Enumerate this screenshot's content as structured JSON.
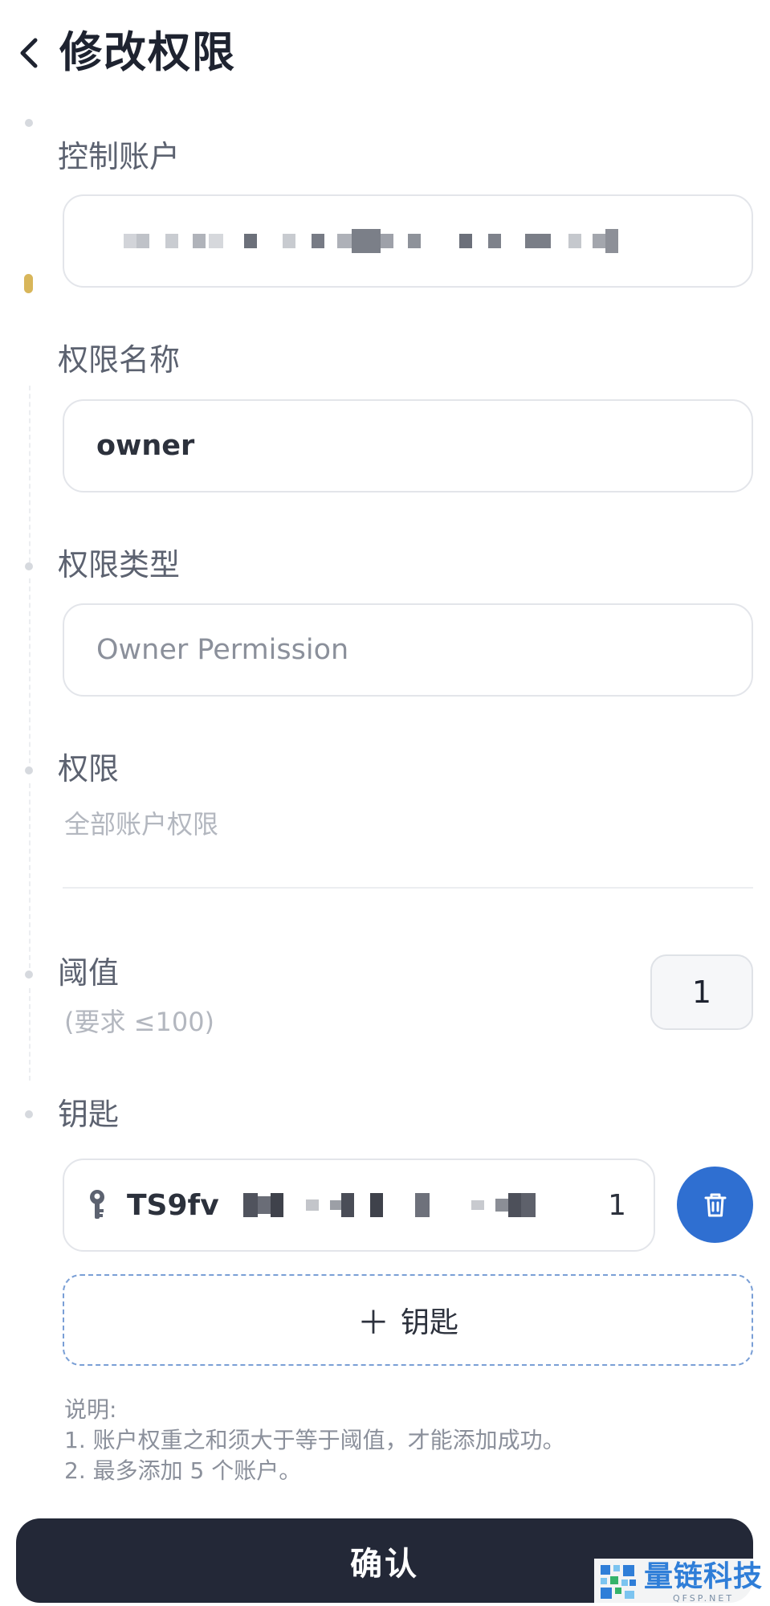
{
  "header": {
    "title": "修改权限"
  },
  "control_account": {
    "label": "控制账户"
  },
  "permission_name": {
    "label": "权限名称",
    "value": "owner"
  },
  "permission_type": {
    "label": "权限类型",
    "value": "Owner Permission"
  },
  "permissions": {
    "label": "权限",
    "value": "全部账户权限"
  },
  "threshold": {
    "label": "阈值",
    "hint": "(要求 ≤100)",
    "value": "1"
  },
  "keys": {
    "label": "钥匙",
    "items": [
      {
        "address_prefix": "TS9fv",
        "weight": "1"
      }
    ],
    "add_label": "钥匙"
  },
  "notes": {
    "title": "说明:",
    "lines": [
      "1. 账户权重之和须大于等于阈值，才能添加成功。",
      "2. 最多添加 5 个账户。"
    ]
  },
  "footer": {
    "confirm_label": "确认"
  },
  "watermark": {
    "name": "量链科技",
    "sub": "QFSP.NET"
  },
  "colors": {
    "accent": "#2f6fd1",
    "active_step": "#d8b65a",
    "primary_button": "#232837"
  }
}
